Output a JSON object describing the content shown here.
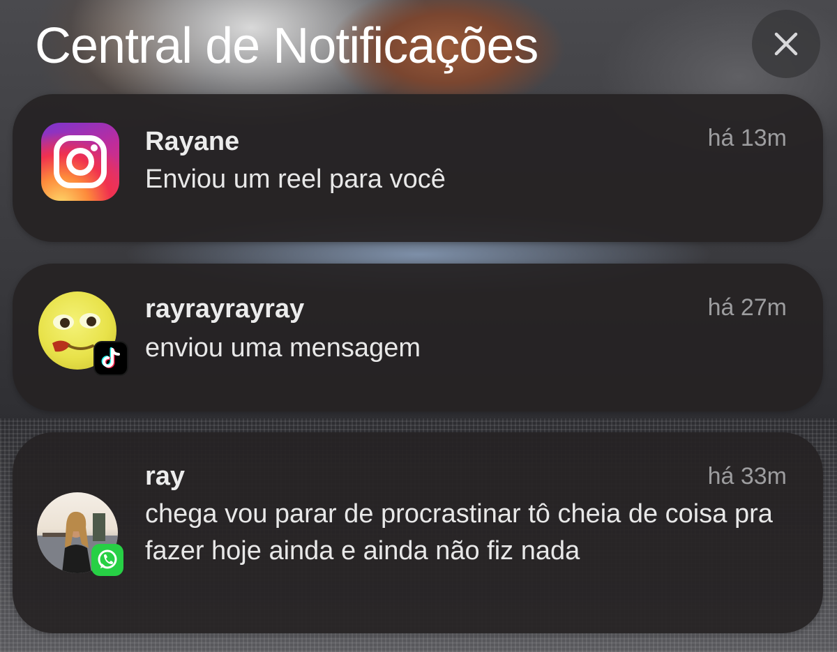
{
  "header": {
    "title": "Central de Notificações",
    "close_icon": "close-icon"
  },
  "notifications": [
    {
      "app": "Instagram",
      "icon": "instagram-icon",
      "sender": "Rayane",
      "message": "Enviou um reel para você",
      "time": "há 13m"
    },
    {
      "app": "TikTok",
      "icon": "tiktok-icon",
      "avatar": "emoji-face-avatar",
      "sender": "rayrayrayray",
      "message": "enviou uma mensagem",
      "time": "há 27m"
    },
    {
      "app": "WhatsApp",
      "icon": "whatsapp-icon",
      "avatar": "profile-photo-avatar",
      "sender": "ray",
      "message": "chega vou parar de procrastinar tô cheia de coisa pra fazer hoje ainda e ainda não fiz nada",
      "time": "há 33m"
    }
  ],
  "colors": {
    "card_background": "#262224",
    "title_text": "#ffffff",
    "secondary_text": "#9d9d9f",
    "whatsapp_green": "#27d045"
  }
}
